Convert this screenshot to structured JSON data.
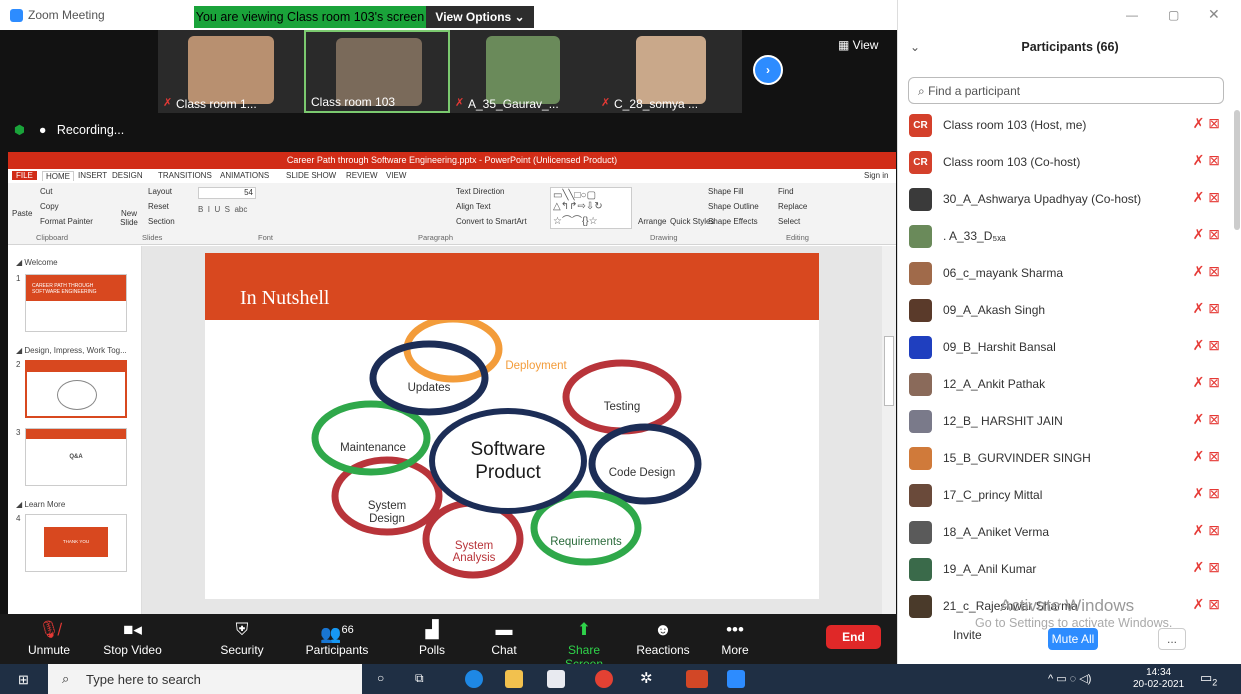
{
  "window": {
    "title": "Zoom Meeting",
    "banner": "You are viewing Class room 103's screen",
    "view_options": "View Options ⌄",
    "view": "View",
    "recording": "Recording..."
  },
  "thumbs": [
    {
      "label": "Class room 1..."
    },
    {
      "label": "Class room 103"
    },
    {
      "label": "A_35_Gaurav_..."
    },
    {
      "label": "C_28_somya ..."
    }
  ],
  "ppt": {
    "title": "Career Path through Software Engineering.pptx - PowerPoint (Unlicensed Product)",
    "signin": "Sign in",
    "menu": [
      "FILE",
      "HOME",
      "INSERT",
      "DESIGN",
      "TRANSITIONS",
      "ANIMATIONS",
      "SLIDE SHOW",
      "REVIEW",
      "VIEW"
    ],
    "clipboard": {
      "paste": "Paste",
      "cut": "Cut",
      "copy": "Copy",
      "format_painter": "Format Painter",
      "group": "Clipboard"
    },
    "slides_grp": {
      "new": "New Slide",
      "layout": "Layout",
      "reset": "Reset",
      "section": "Section",
      "group": "Slides"
    },
    "font_grp": {
      "size": "54",
      "group": "Font"
    },
    "para_grp": {
      "text_direction": "Text Direction",
      "align_text": "Align Text",
      "smartart": "Convert to SmartArt",
      "group": "Paragraph"
    },
    "draw_grp": {
      "arrange": "Arrange",
      "quick_styles": "Quick Styles",
      "shape_fill": "Shape Fill",
      "shape_outline": "Shape Outline",
      "shape_effects": "Shape Effects",
      "group": "Drawing"
    },
    "edit_grp": {
      "find": "Find",
      "replace": "Replace",
      "select": "Select",
      "group": "Editing"
    },
    "sections": [
      {
        "name": "Welcome"
      },
      {
        "name": "Design, Impress, Work Tog..."
      },
      {
        "name": "Learn More"
      }
    ],
    "slide_nums": [
      "1",
      "2",
      "3",
      "4"
    ],
    "thumb1": "CAREER PATH THROUGH SOFTWARE ENGINEERING",
    "thumb3": "Q&A",
    "thumb4": "THANK YOU",
    "slide": {
      "heading": "In Nutshell",
      "center_line1": "Software",
      "center_line2": "Product",
      "petals": [
        "Deployment",
        "Testing",
        "Code Design",
        "Requirements",
        "System Analysis",
        "System Design",
        "Maintenance",
        "Updates"
      ]
    }
  },
  "toolbar": {
    "unmute": "Unmute",
    "stop_video": "Stop Video",
    "security": "Security",
    "participants": "Participants",
    "participants_count": "66",
    "polls": "Polls",
    "chat": "Chat",
    "share": "Share Screen",
    "reactions": "Reactions",
    "more": "More",
    "end": "End"
  },
  "panel": {
    "title": "Participants (66)",
    "search_placeholder": "Find a participant",
    "invite": "Invite",
    "mute_all": "Mute All",
    "more": "...",
    "watermark1": "Activate Windows",
    "watermark2": "Go to Settings to activate Windows.",
    "participants": [
      {
        "name": "Class room 103 (Host, me)",
        "avatar": "CR",
        "color": "#d4402b"
      },
      {
        "name": "Class room 103 (Co-host)",
        "avatar": "CR",
        "color": "#d4402b"
      },
      {
        "name": "30_A_Ashwarya Upadhyay (Co-host)",
        "avatar": "",
        "color": "#3a3a3a"
      },
      {
        "name": ". A_33_D₅ₓₐ",
        "avatar": "",
        "color": "#6a8a5a"
      },
      {
        "name": "06_c_mayank Sharma",
        "avatar": "",
        "color": "#a06a4a"
      },
      {
        "name": "09_A_Akash Singh",
        "avatar": "",
        "color": "#5a3a2a"
      },
      {
        "name": "09_B_Harshit Bansal",
        "avatar": "",
        "color": "#1f3fbf"
      },
      {
        "name": "12_A_Ankit Pathak",
        "avatar": "",
        "color": "#8a6a5a"
      },
      {
        "name": "12_B_ HARSHIT JAIN",
        "avatar": "",
        "color": "#7a7a8a"
      },
      {
        "name": "15_B_GURVINDER SINGH",
        "avatar": "",
        "color": "#d07a3a"
      },
      {
        "name": "17_C_princy Mittal",
        "avatar": "",
        "color": "#6a4a3a"
      },
      {
        "name": "18_A_Aniket Verma",
        "avatar": "",
        "color": "#5a5a5a"
      },
      {
        "name": "19_A_Anil Kumar",
        "avatar": "",
        "color": "#3a6a4a"
      },
      {
        "name": "21_c_Rajeshwar Sharma",
        "avatar": "",
        "color": "#4a3a2a"
      }
    ]
  },
  "taskbar": {
    "search_placeholder": "Type here to search",
    "time": "14:34",
    "date": "20-02-2021",
    "notif": "2"
  }
}
